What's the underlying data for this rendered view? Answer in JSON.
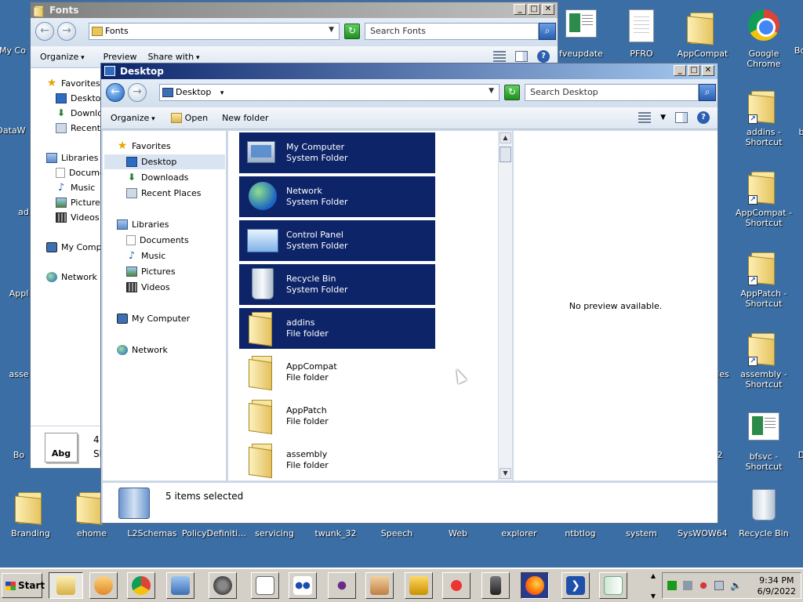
{
  "desktop_icons": [
    {
      "id": "fveupdate",
      "label": "fveupdate",
      "icon": "app"
    },
    {
      "id": "pfro",
      "label": "PFRO",
      "icon": "doc"
    },
    {
      "id": "appcompat",
      "label": "AppCompat",
      "icon": "folder"
    },
    {
      "id": "chrome",
      "label": "Google Chrome",
      "icon": "chrome"
    },
    {
      "id": "addins-sc",
      "label": "addins - Shortcut",
      "icon": "folder-shortcut"
    },
    {
      "id": "appcompat-sc",
      "label": "AppCompat - Shortcut",
      "icon": "folder-shortcut"
    },
    {
      "id": "apppatch-sc",
      "label": "AppPatch - Shortcut",
      "icon": "folder-shortcut"
    },
    {
      "id": "assembly-sc",
      "label": "assembly - Shortcut",
      "icon": "folder-shortcut"
    },
    {
      "id": "bfsvc-sc",
      "label": "bfsvc - Shortcut",
      "icon": "app-shortcut"
    },
    {
      "id": "branding",
      "label": "Branding",
      "icon": "folder"
    },
    {
      "id": "ehome",
      "label": "ehome",
      "icon": "folder"
    },
    {
      "id": "l2schemas",
      "label": "L2Schemas",
      "icon": "folder"
    },
    {
      "id": "policydef",
      "label": "PolicyDefiniti...",
      "icon": "folder"
    },
    {
      "id": "servicing",
      "label": "servicing",
      "icon": "folder"
    },
    {
      "id": "twunk32",
      "label": "twunk_32",
      "icon": "app"
    },
    {
      "id": "speech",
      "label": "Speech",
      "icon": "folder"
    },
    {
      "id": "web",
      "label": "Web",
      "icon": "folder"
    },
    {
      "id": "explorer",
      "label": "explorer",
      "icon": "folder"
    },
    {
      "id": "ntbtlog",
      "label": "ntbtlog",
      "icon": "doc"
    },
    {
      "id": "system",
      "label": "system",
      "icon": "folder"
    },
    {
      "id": "syswow64",
      "label": "SysWOW64",
      "icon": "folder"
    },
    {
      "id": "recyclebin",
      "label": "Recycle Bin",
      "icon": "bin"
    }
  ],
  "desktop_partial_labels": {
    "mycomputer": "My Co",
    "dataw": "DataW",
    "ad": "ad",
    "appl": "Appl",
    "asse": "asse",
    "bo": "Bo",
    "les": "les",
    "b": "b",
    "d": "D",
    "two": "2",
    "bo2": "Bo"
  },
  "fonts_window": {
    "title": "Fonts",
    "address": "Fonts",
    "search_placeholder": "Search Fonts",
    "cmd": {
      "organize": "Organize",
      "preview": "Preview",
      "share_with": "Share with"
    },
    "nav": {
      "favorites": "Favorites",
      "desktop": "Desktop",
      "downloads": "Downlo",
      "recent": "Recent",
      "libraries": "Libraries",
      "documents": "Docume",
      "music": "Music",
      "pictures": "Pictures",
      "videos": "Videos",
      "my_computer": "My Compu",
      "network": "Network"
    },
    "font_sample": "Abg",
    "font_partial_1": "4",
    "font_partial_2": "Sh"
  },
  "desktop_window": {
    "title": "Desktop",
    "address": "Desktop",
    "search_placeholder": "Search Desktop",
    "cmd": {
      "organize": "Organize",
      "open": "Open",
      "new_folder": "New folder"
    },
    "nav": {
      "favorites": "Favorites",
      "desktop": "Desktop",
      "downloads": "Downloads",
      "recent_places": "Recent Places",
      "libraries": "Libraries",
      "documents": "Documents",
      "music": "Music",
      "pictures": "Pictures",
      "videos": "Videos",
      "my_computer": "My Computer",
      "network": "Network"
    },
    "items": [
      {
        "name": "My Computer",
        "type": "System Folder",
        "icon": "computer",
        "selected": true
      },
      {
        "name": "Network",
        "type": "System Folder",
        "icon": "globe",
        "selected": true
      },
      {
        "name": "Control Panel",
        "type": "System Folder",
        "icon": "controlpanel",
        "selected": true
      },
      {
        "name": "Recycle Bin",
        "type": "System Folder",
        "icon": "bin",
        "selected": true
      },
      {
        "name": "addins",
        "type": "File folder",
        "icon": "folder",
        "selected": true
      },
      {
        "name": "AppCompat",
        "type": "File folder",
        "icon": "folder",
        "selected": false
      },
      {
        "name": "AppPatch",
        "type": "File folder",
        "icon": "folder",
        "selected": false
      },
      {
        "name": "assembly",
        "type": "File folder",
        "icon": "folder",
        "selected": false
      }
    ],
    "preview_text": "No preview available.",
    "status_text": "5 items selected"
  },
  "taskbar": {
    "start_label": "Start",
    "time": "9:34 PM",
    "date": "6/9/2022"
  }
}
